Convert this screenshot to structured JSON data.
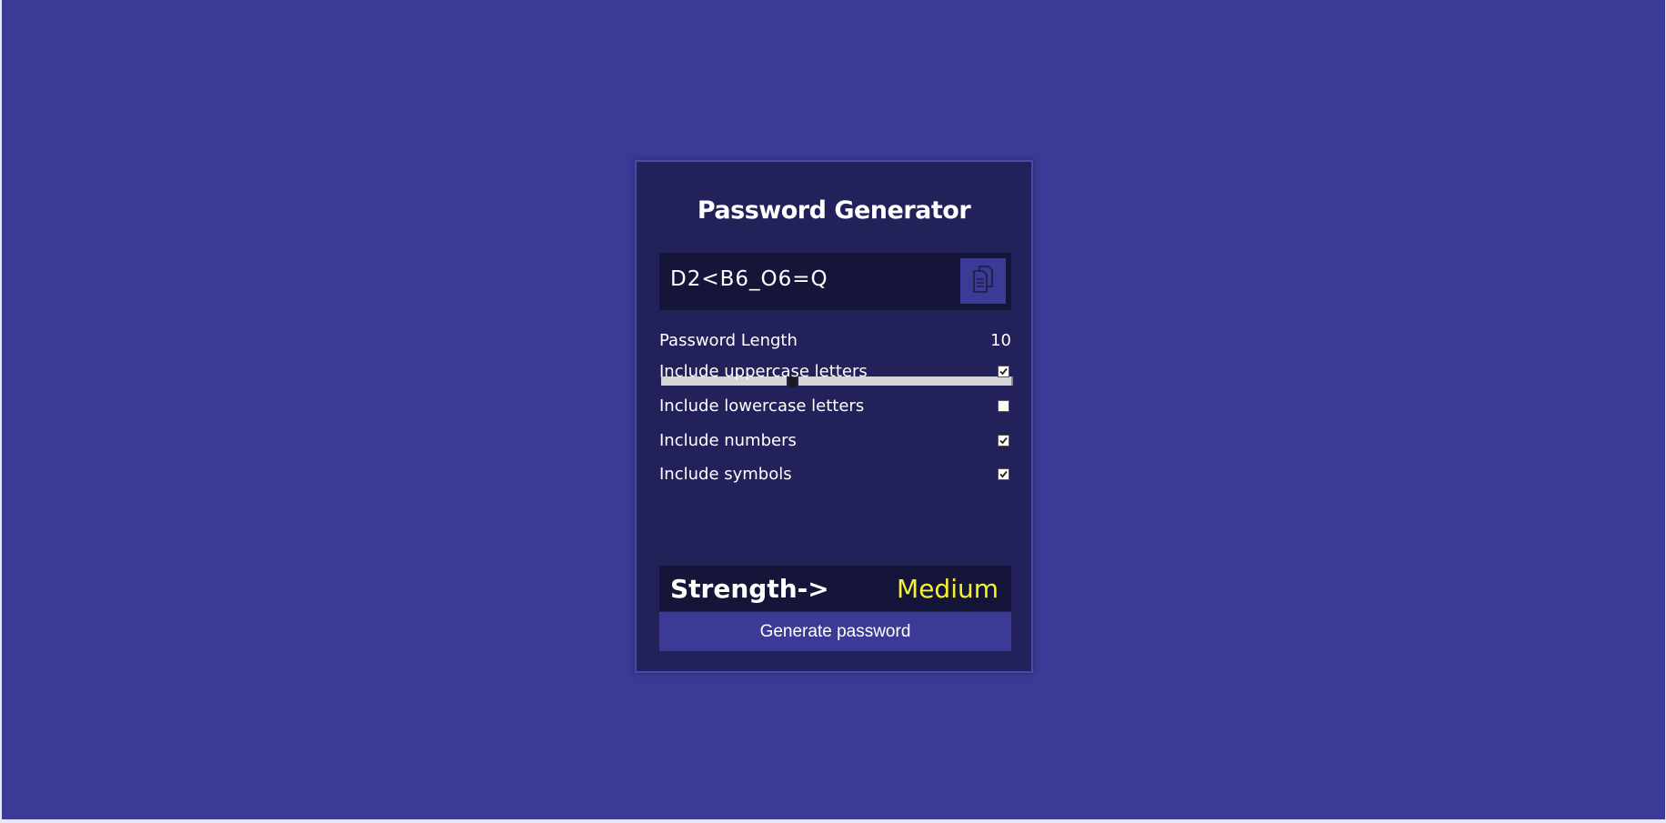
{
  "app": {
    "title": "Password Generator"
  },
  "password": {
    "value": "D2<B6_O6=Q",
    "copy_icon": "copy-icon"
  },
  "length": {
    "label": "Password Length",
    "value": "10",
    "slider_fraction": 0.375
  },
  "options": [
    {
      "label": "Include uppercase letters",
      "checked": true
    },
    {
      "label": "Include lowercase letters",
      "checked": false
    },
    {
      "label": "Include numbers",
      "checked": true
    },
    {
      "label": "Include symbols",
      "checked": true
    }
  ],
  "strength": {
    "label": "Strength->",
    "value": "Medium",
    "color": "#f5f233"
  },
  "actions": {
    "generate_label": "Generate password"
  },
  "colors": {
    "background": "#3b3b97",
    "card": "#23215a",
    "dark_panel": "#15153a",
    "accent": "#3b3b97"
  }
}
